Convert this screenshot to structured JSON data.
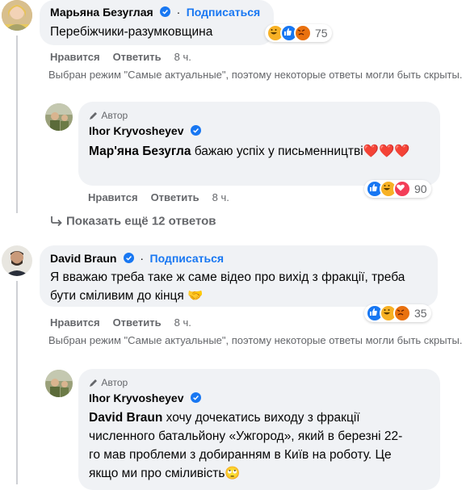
{
  "comments": [
    {
      "author": "Марьяна Безуглая",
      "follow_label": "Подписаться",
      "text": "Перебіжчики-разумковщина",
      "reaction_count": "75",
      "like_label": "Нравится",
      "reply_label": "Ответить",
      "time": "8 ч.",
      "notice": "Выбран режим \"Самые актуальные\", поэтому некоторые ответы могли быть скрыты.",
      "reply": {
        "author_badge": "Автор",
        "author": "Ihor Kryvosheyev",
        "mention": "Мар'яна Безугла",
        "text": " бажаю успіх у письменництві❤️❤️❤️",
        "reaction_count": "90",
        "like_label": "Нравится",
        "reply_label": "Ответить",
        "time": "8 ч."
      },
      "more_replies_label": "Показать ещё 12 ответов"
    },
    {
      "author": "David Braun",
      "follow_label": "Подписаться",
      "text": "Я вважаю треба таке ж саме відео про вихід з фракції, треба бути сміливим до кінця 🤝",
      "reaction_count": "35",
      "like_label": "Нравится",
      "reply_label": "Ответить",
      "time": "8 ч.",
      "notice": "Выбран режим \"Самые актуальные\", поэтому некоторые ответы могли быть скрыты.",
      "reply": {
        "author_badge": "Автор",
        "author": "Ihor Kryvosheyev",
        "mention": "David Braun",
        "text": " хочу дочекатись виходу з фракції численного батальйону «Ужгород», який в березні 22-го мав проблеми з добиранням в Київ на роботу. Це якщо ми про сміливість🙄"
      }
    }
  ],
  "colors": {
    "accent": "#1877f2",
    "bubble": "#f0f2f5",
    "secondary_text": "#65676b",
    "like": "#1877f2",
    "haha": "#f7b125",
    "angry": "#e9710f",
    "love": "#f33e58"
  },
  "icons": [
    "verified-icon",
    "pencil-icon",
    "reply-arrow-icon",
    "like-reaction-icon",
    "haha-reaction-icon",
    "angry-reaction-icon",
    "love-reaction-icon"
  ]
}
